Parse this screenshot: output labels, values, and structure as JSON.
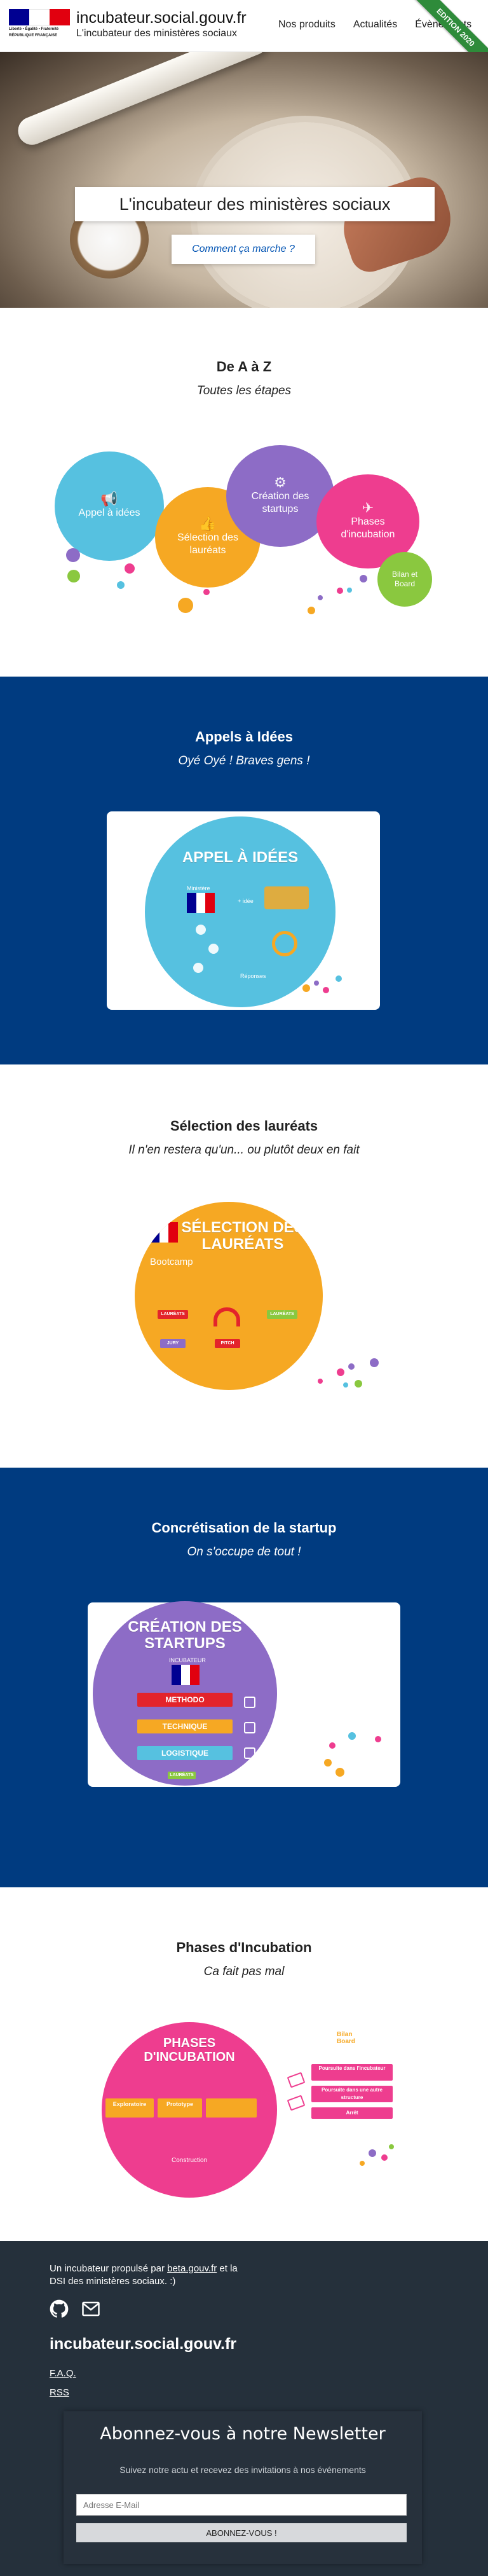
{
  "header": {
    "motto": "Liberté • Égalité • Fraternité",
    "republic": "RÉPUBLIQUE FRANÇAISE",
    "site_name": "incubateur.social.gouv.fr",
    "site_sub": "L'incubateur des ministères sociaux",
    "nav": [
      "Nos produits",
      "Actualités",
      "Évènements"
    ],
    "ribbon": "EDITION 2020"
  },
  "hero": {
    "title": "L'incubateur des ministères sociaux",
    "button": "Comment ça marche ?"
  },
  "atoz": {
    "title": "De A à Z",
    "subtitle": "Toutes les étapes",
    "bubbles": [
      "Appel à idées",
      "Sélection des lauréats",
      "Création des startups",
      "Phases d'incubation",
      "Bilan et Board"
    ]
  },
  "appels": {
    "title": "Appels à Idées",
    "subtitle": "Oyé Oyé ! Braves gens !",
    "art_title": "APPEL À IDÉES",
    "labels": [
      "Ministère",
      "+ idée",
      "Réponses"
    ]
  },
  "selection": {
    "title": "Sélection des lauréats",
    "subtitle": "Il n'en restera qu'un... ou plutôt deux en fait",
    "art_title": "SÉLECTION DES LAURÉATS",
    "bootcamp": "Bootcamp",
    "tags": [
      "LAURÉATS",
      "JURY",
      "PITCH",
      "LAURÉATS"
    ]
  },
  "creation": {
    "title": "Concrétisation de la startup",
    "subtitle": "On s'occupe de tout !",
    "art_title": "CRÉATION DES STARTUPS",
    "ministry": "INCUBATEUR",
    "bars": [
      "METHODO",
      "TECHNIQUE",
      "LOGISTIQUE"
    ],
    "tag": "LAURÉATS"
  },
  "phases": {
    "title": "Phases d'Incubation",
    "subtitle": "Ca fait pas mal",
    "art_title": "PHASES D'INCUBATION",
    "steps": [
      "Exploratoire",
      "Prototype",
      "Construction"
    ],
    "end_items": [
      "Poursuite dans l'incubateur",
      "Poursuite dans une autre structure",
      "Arrêt"
    ],
    "board": "Bilan Board"
  },
  "footer": {
    "text_before": "Un incubateur propulsé par ",
    "link": "beta.gouv.fr",
    "text_after": " et la DSI des ministères sociaux. :)",
    "brand": "incubateur.social.gouv.fr",
    "links": [
      "F.A.Q.",
      "RSS"
    ],
    "newsletter": {
      "title": "Abonnez-vous à notre Newsletter",
      "subtitle": "Suivez notre actu et recevez des invitations à nos événements",
      "placeholder": "Adresse E-Mail",
      "button": "ABONNEZ-VOUS !"
    }
  },
  "colors": {
    "blue": "#003b80",
    "cyan": "#56c1e0",
    "orange": "#f6a823",
    "purple": "#8d6cc6",
    "pink": "#ee3d8f",
    "green": "#8ac83f"
  }
}
